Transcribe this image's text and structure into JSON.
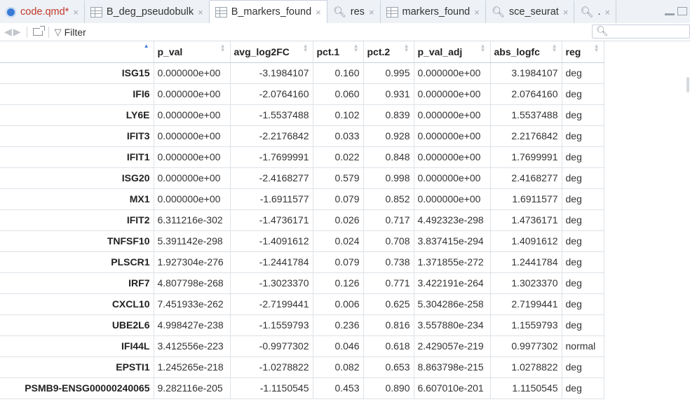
{
  "tabs": [
    {
      "label": "code.qmd*",
      "icon": "qmd-file-icon",
      "modified": true,
      "active": false
    },
    {
      "label": "B_deg_pseudobulk",
      "icon": "table-icon",
      "active": false
    },
    {
      "label": "B_markers_found",
      "icon": "table-icon",
      "active": true
    },
    {
      "label": "res",
      "icon": "search-icon",
      "active": false
    },
    {
      "label": "markers_found",
      "icon": "table-icon",
      "active": false
    },
    {
      "label": "sce_seurat",
      "icon": "search-icon",
      "active": false
    },
    {
      "label": ".",
      "icon": "search-icon",
      "active": false
    }
  ],
  "tab_close_glyph": "×",
  "toolbar": {
    "filter_label": "Filter",
    "search_value": ""
  },
  "table": {
    "columns": [
      "",
      "p_val",
      "avg_log2FC",
      "pct.1",
      "pct.2",
      "p_val_adj",
      "abs_logfc",
      "reg"
    ],
    "sorted_column": "rownames",
    "rows": [
      [
        "ISG15",
        "0.000000e+00",
        "-3.1984107",
        "0.160",
        "0.995",
        "0.000000e+00",
        "3.1984107",
        "deg"
      ],
      [
        "IFI6",
        "0.000000e+00",
        "-2.0764160",
        "0.060",
        "0.931",
        "0.000000e+00",
        "2.0764160",
        "deg"
      ],
      [
        "LY6E",
        "0.000000e+00",
        "-1.5537488",
        "0.102",
        "0.839",
        "0.000000e+00",
        "1.5537488",
        "deg"
      ],
      [
        "IFIT3",
        "0.000000e+00",
        "-2.2176842",
        "0.033",
        "0.928",
        "0.000000e+00",
        "2.2176842",
        "deg"
      ],
      [
        "IFIT1",
        "0.000000e+00",
        "-1.7699991",
        "0.022",
        "0.848",
        "0.000000e+00",
        "1.7699991",
        "deg"
      ],
      [
        "ISG20",
        "0.000000e+00",
        "-2.4168277",
        "0.579",
        "0.998",
        "0.000000e+00",
        "2.4168277",
        "deg"
      ],
      [
        "MX1",
        "0.000000e+00",
        "-1.6911577",
        "0.079",
        "0.852",
        "0.000000e+00",
        "1.6911577",
        "deg"
      ],
      [
        "IFIT2",
        "6.311216e-302",
        "-1.4736171",
        "0.026",
        "0.717",
        "4.492323e-298",
        "1.4736171",
        "deg"
      ],
      [
        "TNFSF10",
        "5.391142e-298",
        "-1.4091612",
        "0.024",
        "0.708",
        "3.837415e-294",
        "1.4091612",
        "deg"
      ],
      [
        "PLSCR1",
        "1.927304e-276",
        "-1.2441784",
        "0.079",
        "0.738",
        "1.371855e-272",
        "1.2441784",
        "deg"
      ],
      [
        "IRF7",
        "4.807798e-268",
        "-1.3023370",
        "0.126",
        "0.771",
        "3.422191e-264",
        "1.3023370",
        "deg"
      ],
      [
        "CXCL10",
        "7.451933e-262",
        "-2.7199441",
        "0.006",
        "0.625",
        "5.304286e-258",
        "2.7199441",
        "deg"
      ],
      [
        "UBE2L6",
        "4.998427e-238",
        "-1.1559793",
        "0.236",
        "0.816",
        "3.557880e-234",
        "1.1559793",
        "deg"
      ],
      [
        "IFI44L",
        "3.412556e-223",
        "-0.9977302",
        "0.046",
        "0.618",
        "2.429057e-219",
        "0.9977302",
        "normal"
      ],
      [
        "EPSTI1",
        "1.245265e-218",
        "-1.0278822",
        "0.082",
        "0.653",
        "8.863798e-215",
        "1.0278822",
        "deg"
      ],
      [
        "PSMB9-ENSG00000240065",
        "9.282116e-205",
        "-1.1150545",
        "0.453",
        "0.890",
        "6.607010e-201",
        "1.1150545",
        "deg"
      ]
    ]
  }
}
